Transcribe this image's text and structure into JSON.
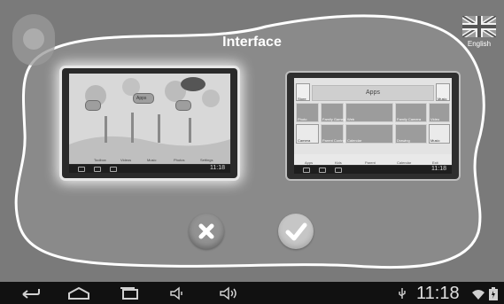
{
  "title": "Interface",
  "language": "English",
  "colors": {
    "background": "#7a7a7a",
    "outline": "#ffffff",
    "system_bar": "#111111"
  },
  "left_preview": {
    "home_icons": [
      "Kid Apps",
      "Apps",
      "Kid Apps"
    ],
    "dock": [
      "Toolbox",
      "Videos",
      "Music",
      "Photos",
      "Settings"
    ],
    "time": "11:18"
  },
  "right_preview": {
    "header": "Apps",
    "tiles": [
      "Photo",
      "Family Games",
      "Web",
      "Family Camera",
      "Video",
      "Camera",
      "Parent Control",
      "Calendar",
      "Drawing",
      "Music"
    ],
    "side_left": "Store",
    "side_right": "Music",
    "bottom_items": [
      "Apps",
      "Kids",
      "Parent",
      "Calendar",
      "Exit"
    ],
    "time": "11:18"
  },
  "buttons": {
    "cancel_icon": "x-icon",
    "confirm_icon": "checkmark-icon"
  },
  "system_bar": {
    "icons": [
      "back-icon",
      "home-icon",
      "recent-apps-icon",
      "volume-down-icon",
      "volume-up-icon"
    ],
    "status_icons": [
      "usb-icon",
      "wifi-icon",
      "battery-icon"
    ],
    "time": "11:18"
  }
}
